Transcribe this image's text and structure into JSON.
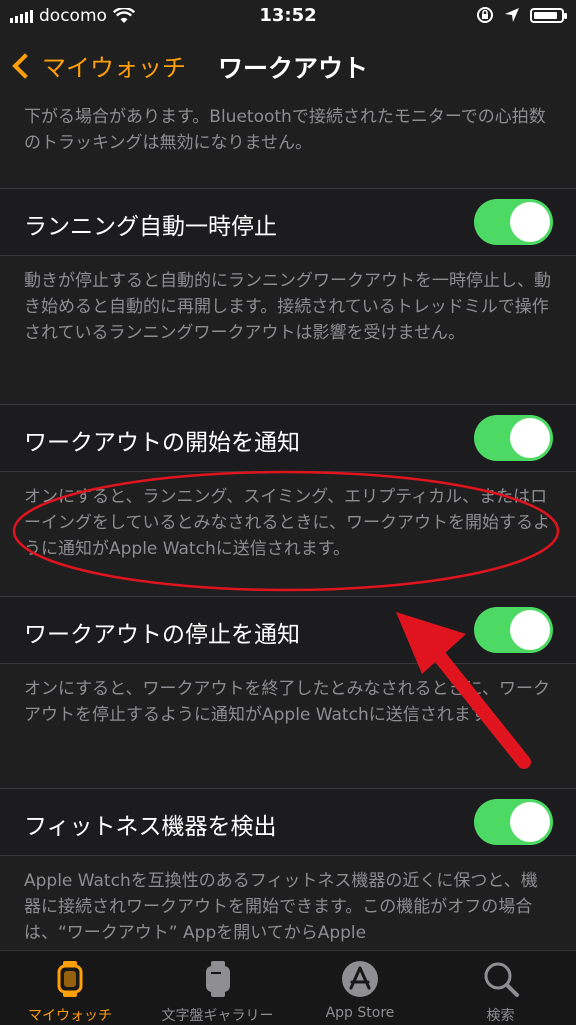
{
  "status": {
    "carrier": "docomo",
    "time": "13:52",
    "battery_level": 0.9
  },
  "nav": {
    "back_label": "マイウォッチ",
    "title": "ワークアウト"
  },
  "top_footer": "下がる場合があります。Bluetoothで接続されたモニターでの心拍数のトラッキングは無効になりません。",
  "settings": [
    {
      "label": "ランニング自動一時停止",
      "on": true,
      "description": "動きが停止すると自動的にランニングワークアウトを一時停止し、動き始めると自動的に再開します。接続されているトレッドミルで操作されているランニングワークアウトは影響を受けません。"
    },
    {
      "label": "ワークアウトの開始を通知",
      "on": true,
      "description": "オンにすると、ランニング、スイミング、エリプティカル、またはローイングをしているとみなされるときに、ワークアウトを開始するように通知がApple Watchに送信されます。"
    },
    {
      "label": "ワークアウトの停止を通知",
      "on": true,
      "description": "オンにすると、ワークアウトを終了したとみなされるときに、ワークアウトを停止するように通知がApple Watchに送信されます。"
    },
    {
      "label": "フィットネス機器を検出",
      "on": true,
      "description": "Apple Watchを互換性のあるフィットネス機器の近くに保つと、機器に接続されワークアウトを開始できます。この機能がオフの場合は、“ワークアウト” Appを開いてからApple"
    }
  ],
  "tabs": [
    {
      "label": "マイウォッチ",
      "icon": "watch-icon",
      "active": true
    },
    {
      "label": "文字盤ギャラリー",
      "icon": "watch-face-icon",
      "active": false
    },
    {
      "label": "App Store",
      "icon": "app-store-icon",
      "active": false
    },
    {
      "label": "検索",
      "icon": "search-icon",
      "active": false
    }
  ],
  "colors": {
    "accent": "#ff9f0a",
    "toggle_on": "#4cd964",
    "annotation": "#e0141e",
    "footer_text": "#8d8d92"
  }
}
